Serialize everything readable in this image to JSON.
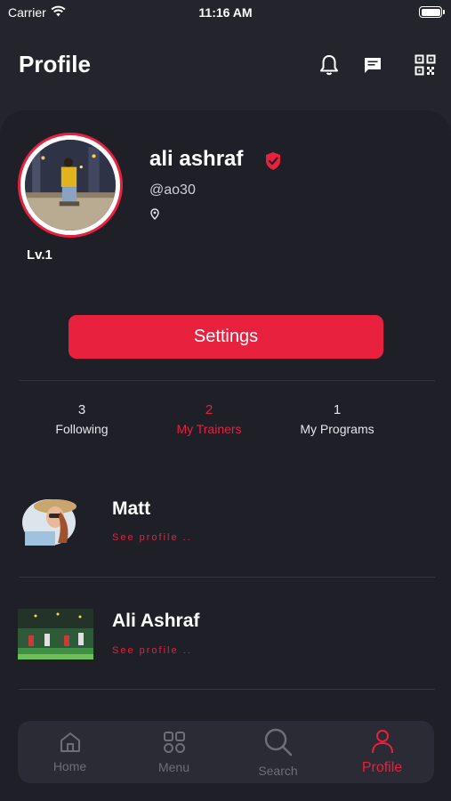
{
  "status_bar": {
    "carrier": "Carrier",
    "time": "11:16 AM",
    "battery_level": 1.0
  },
  "header": {
    "title": "Profile",
    "icons": [
      "bell-icon",
      "message-icon",
      "qr-code-icon"
    ]
  },
  "profile": {
    "name": "ali ashraf",
    "handle": "@ao30",
    "level": "Lv.1",
    "settings_label": "Settings"
  },
  "stats": [
    {
      "count": "3",
      "label": "Following",
      "active": false
    },
    {
      "count": "2",
      "label": "My Trainers",
      "active": true
    },
    {
      "count": "1",
      "label": "My Programs",
      "active": false
    }
  ],
  "trainers": [
    {
      "name": "Matt",
      "link": "See profile .."
    },
    {
      "name": "Ali Ashraf",
      "link": "See profile .."
    }
  ],
  "tab_bar": [
    {
      "label": "Home",
      "icon": "home-icon"
    },
    {
      "label": "Menu",
      "icon": "grid-icon"
    },
    {
      "label": "Search",
      "icon": "search-icon"
    },
    {
      "label": "Profile",
      "icon": "user-icon",
      "active": true
    }
  ],
  "colors": {
    "accent": "#e8213f",
    "background": "#24252c",
    "card": "#1e1f27",
    "tab_bar": "#2a2b34"
  }
}
